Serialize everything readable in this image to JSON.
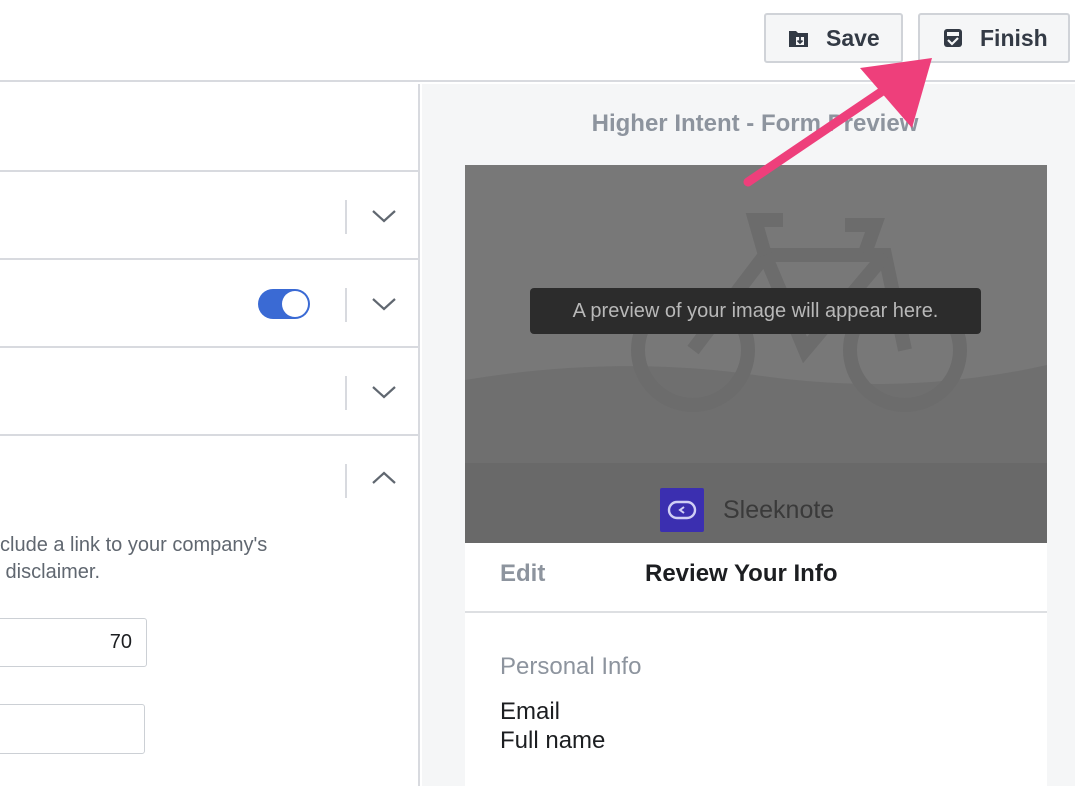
{
  "toolbar": {
    "save_label": "Save",
    "finish_label": "Finish"
  },
  "left_panel": {
    "toggle_on": true,
    "help_text": "clude a link to your company's\n disclaimer.",
    "number_field_value": "70",
    "text_field_value": ""
  },
  "preview": {
    "title": "Higher Intent - Form Preview",
    "image_caption": "A preview of your image will appear here.",
    "brand_name": "Sleeknote",
    "tabs": {
      "edit": "Edit",
      "review": "Review Your Info"
    },
    "section_label": "Personal Info",
    "fields": [
      "Email",
      "Full name"
    ]
  },
  "colors": {
    "accent": "#3a6ad4",
    "annotation_arrow": "#ee3f7b",
    "brand_logo": "#3b2fb0"
  }
}
